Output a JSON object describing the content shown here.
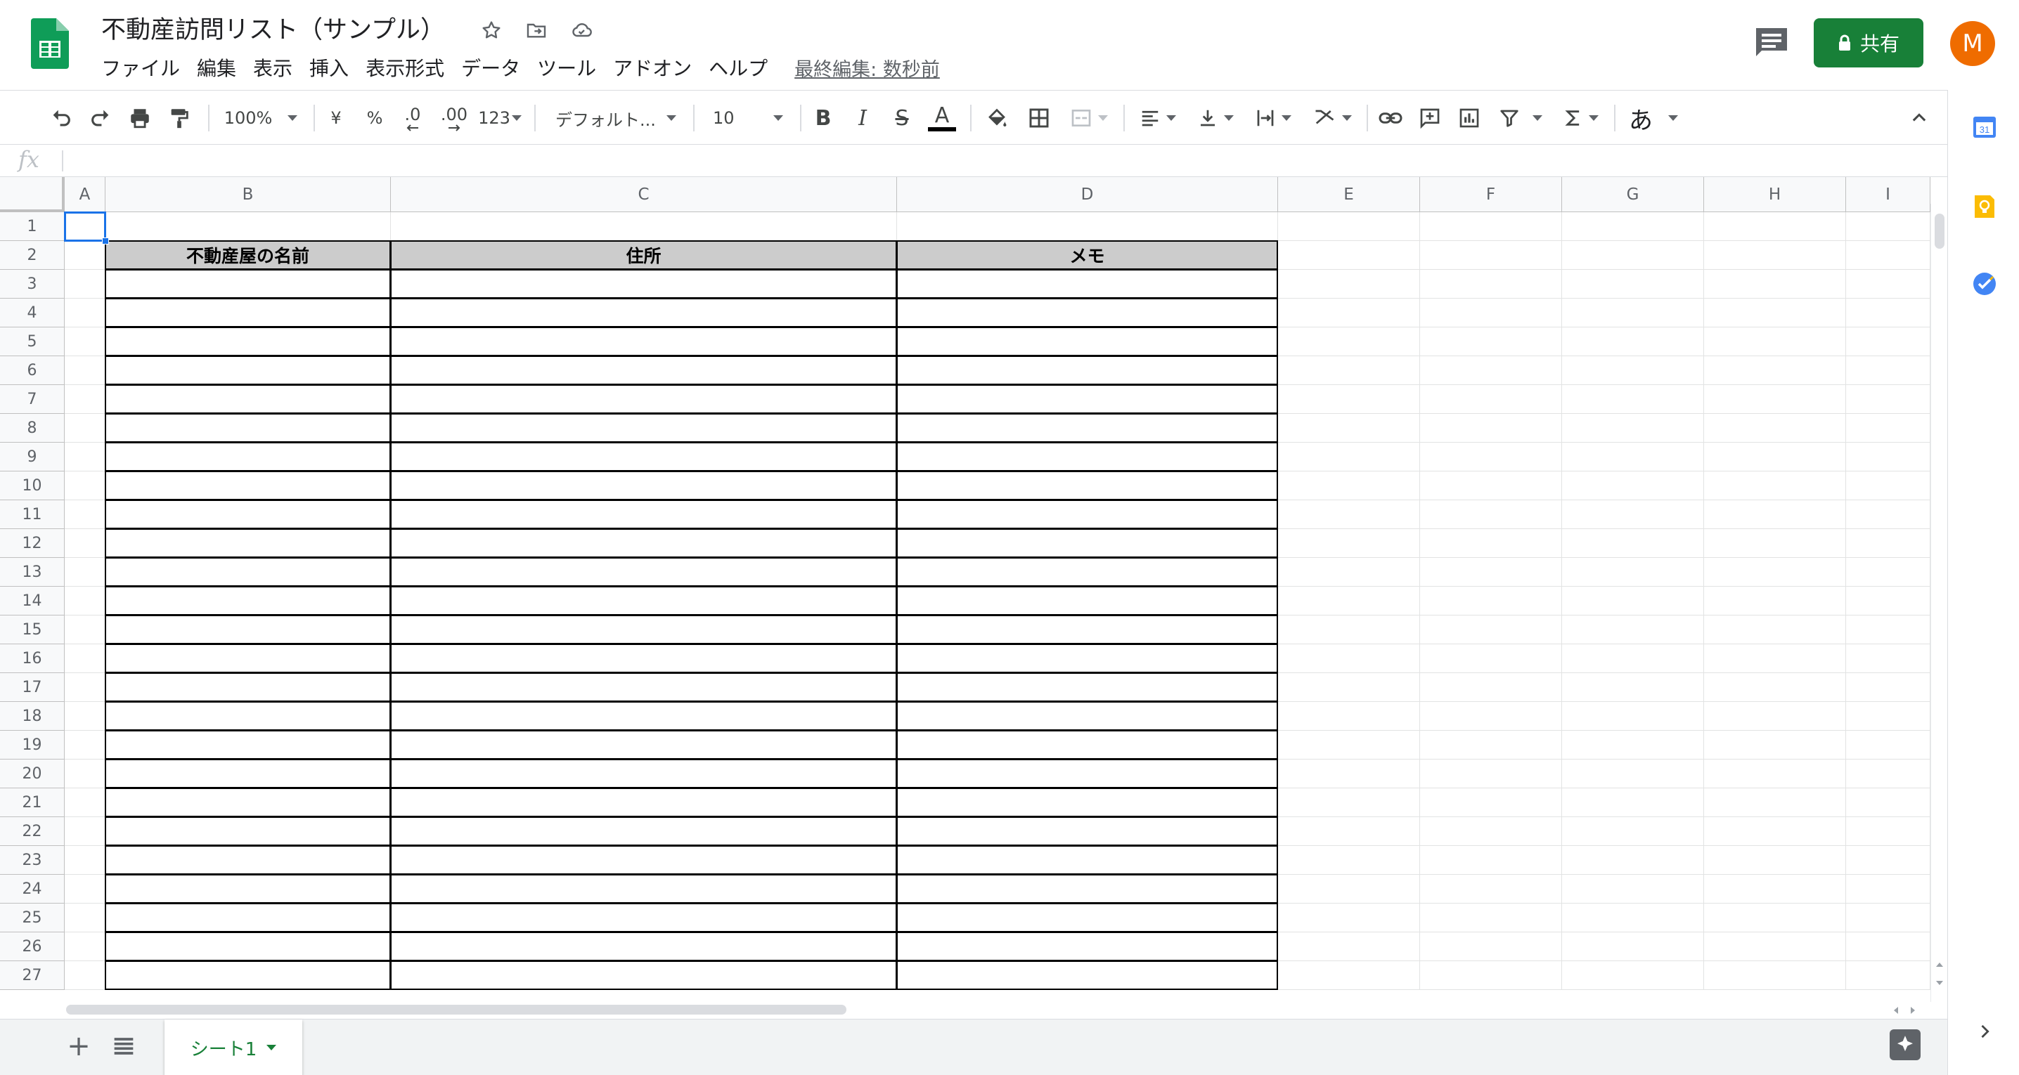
{
  "app": {
    "doc_title": "不動産訪問リスト（サンプル）",
    "menu": [
      "ファイル",
      "編集",
      "表示",
      "挿入",
      "表示形式",
      "データ",
      "ツール",
      "アドオン",
      "ヘルプ"
    ],
    "last_edit": "最終編集: 数秒前",
    "share_label": "共有",
    "avatar_letter": "M",
    "accent_color": "#188038",
    "avatar_color": "#ef6c00"
  },
  "toolbar": {
    "zoom": "100%",
    "currency": "¥",
    "percent": "%",
    "dec_decrease": ".0",
    "dec_increase": ".00",
    "more_formats": "123",
    "font": "デフォルト...",
    "font_size": "10",
    "bold": "B",
    "italic": "I",
    "strike": "S",
    "text_color": "A",
    "input_tools": "あ"
  },
  "formula_bar": {
    "label": "fx",
    "value": ""
  },
  "sheet": {
    "columns": [
      "A",
      "B",
      "C",
      "D",
      "E",
      "F",
      "G",
      "H",
      "I"
    ],
    "rows": [
      "1",
      "2",
      "3",
      "4",
      "5",
      "6",
      "7",
      "8",
      "9",
      "10",
      "11",
      "12",
      "13",
      "14",
      "15",
      "16",
      "17",
      "18",
      "19",
      "20",
      "21",
      "22",
      "23",
      "24",
      "25",
      "26",
      "27"
    ],
    "table_headers": [
      "不動産屋の名前",
      "住所",
      "メモ"
    ],
    "selected_cell": "A1"
  },
  "sheets": {
    "tabs": [
      "シート1"
    ],
    "active": "シート1"
  },
  "side_panel": {
    "icons": [
      "calendar-icon",
      "keep-icon",
      "tasks-icon"
    ],
    "calendar_day": "31"
  }
}
